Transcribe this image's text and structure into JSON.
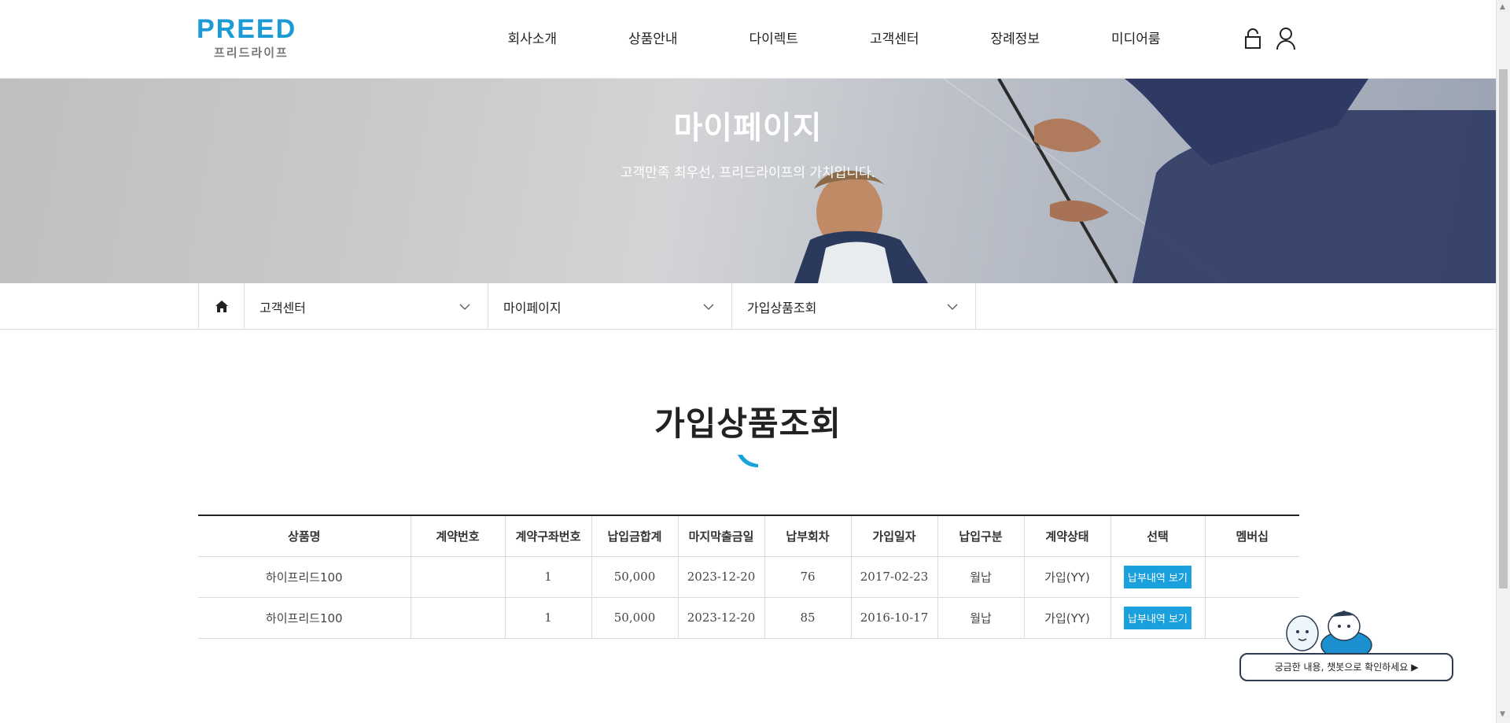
{
  "header": {
    "logo_main": "PREED",
    "logo_sub": "프리드라이프",
    "nav": [
      "회사소개",
      "상품안내",
      "다이렉트",
      "고객센터",
      "장례정보",
      "미디어룸"
    ],
    "icons": [
      "lock-icon",
      "user-icon"
    ]
  },
  "banner": {
    "title": "마이페이지",
    "subtitle": "고객만족 최우선, 프리드라이프의 가치입니다."
  },
  "location": {
    "home_icon": "home-icon",
    "level1": "고객센터",
    "level2": "마이페이지",
    "level3": "가입상품조회"
  },
  "page": {
    "title": "가입상품조회"
  },
  "table": {
    "headers": [
      "상품명",
      "계약번호",
      "계약구좌번호",
      "납입금합계",
      "마지막출금일",
      "납부회차",
      "가입일자",
      "납입구분",
      "계약상태",
      "선택",
      "멤버십"
    ],
    "rows": [
      {
        "product": "하이프리드100",
        "contract_no": "",
        "account_no": "1",
        "total": "50,000",
        "last_withdrawal": "2023-12-20",
        "count": "76",
        "join_date": "2017-02-23",
        "pay_type": "월납",
        "status": "가입(YY)",
        "action": "납부내역 보기",
        "membership": ""
      },
      {
        "product": "하이프리드100",
        "contract_no": "",
        "account_no": "1",
        "total": "50,000",
        "last_withdrawal": "2023-12-20",
        "count": "85",
        "join_date": "2016-10-17",
        "pay_type": "월납",
        "status": "가입(YY)",
        "action": "납부내역 보기",
        "membership": ""
      }
    ]
  },
  "chatbot": {
    "label": "궁금한 내용, 챗봇으로 확인하세요 ▶"
  },
  "colors": {
    "brand": "#1b9ad6",
    "button": "#1aa0dc",
    "chat_border": "#2c3b4e"
  }
}
